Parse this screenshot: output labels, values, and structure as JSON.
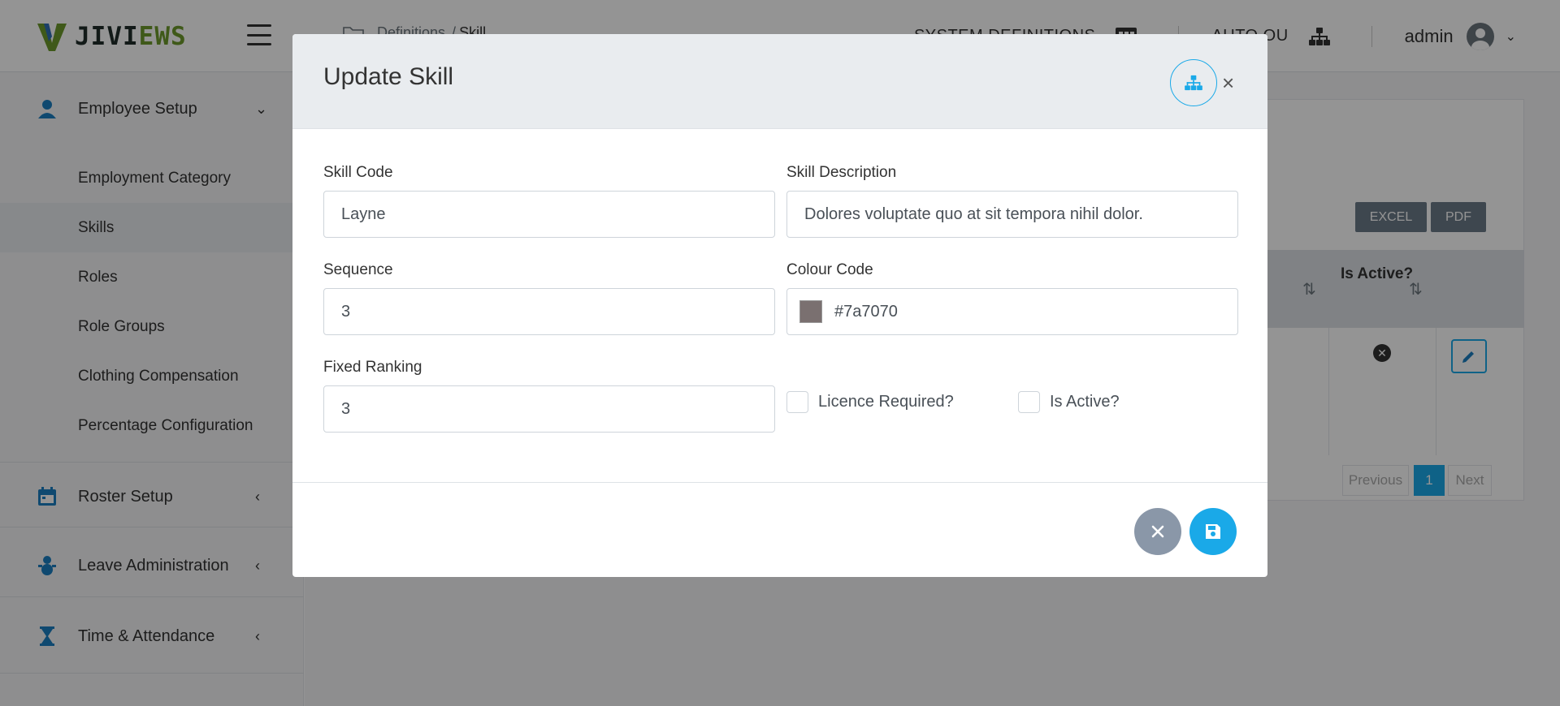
{
  "app": {
    "logo_text": "JIVIEWS",
    "breadcrumb": {
      "parent": "Definitions",
      "separator": "/",
      "current": "Skill"
    },
    "top_links": {
      "system_definitions": "SYSTEM DEFINITIONS",
      "auto_ou": "AUTO OU"
    },
    "user": {
      "name": "admin"
    }
  },
  "sidebar": {
    "groups": [
      {
        "label": "Employee Setup",
        "icon": "employee-icon",
        "arrow": "expanded"
      },
      {
        "label": "Roster Setup",
        "icon": "calendar-icon",
        "arrow": "collapsed"
      },
      {
        "label": "Leave Administration",
        "icon": "leave-icon",
        "arrow": "collapsed"
      },
      {
        "label": "Time & Attendance",
        "icon": "hourglass-icon",
        "arrow": "collapsed"
      }
    ],
    "items": [
      {
        "label": "Employment Category"
      },
      {
        "label": "Skills",
        "active": true
      },
      {
        "label": "Roles"
      },
      {
        "label": "Role Groups"
      },
      {
        "label": "Clothing Compensation"
      },
      {
        "label": "Percentage Configuration"
      }
    ]
  },
  "main": {
    "export_buttons": {
      "excel": "EXCEL",
      "pdf": "PDF"
    },
    "table": {
      "column_is_active": "Is Active?"
    },
    "pagination": {
      "previous": "Previous",
      "page": "1",
      "next": "Next"
    }
  },
  "modal": {
    "title": "Update Skill",
    "fields": {
      "skill_code": {
        "label": "Skill Code",
        "value": "Layne"
      },
      "skill_description": {
        "label": "Skill Description",
        "value": "Dolores voluptate quo at sit tempora nihil dolor."
      },
      "sequence": {
        "label": "Sequence",
        "value": "3"
      },
      "colour_code": {
        "label": "Colour Code",
        "value": "#7a7070"
      },
      "fixed_ranking": {
        "label": "Fixed Ranking",
        "value": "3"
      }
    },
    "checkboxes": {
      "licence_required": {
        "label": "Licence Required?",
        "checked": false
      },
      "is_active": {
        "label": "Is Active?",
        "checked": false
      }
    }
  },
  "colors": {
    "primary": "#1aa9e8",
    "danger": "#dc3545",
    "swatch": "#7a7070",
    "logo_green": "#6d9a2b"
  }
}
